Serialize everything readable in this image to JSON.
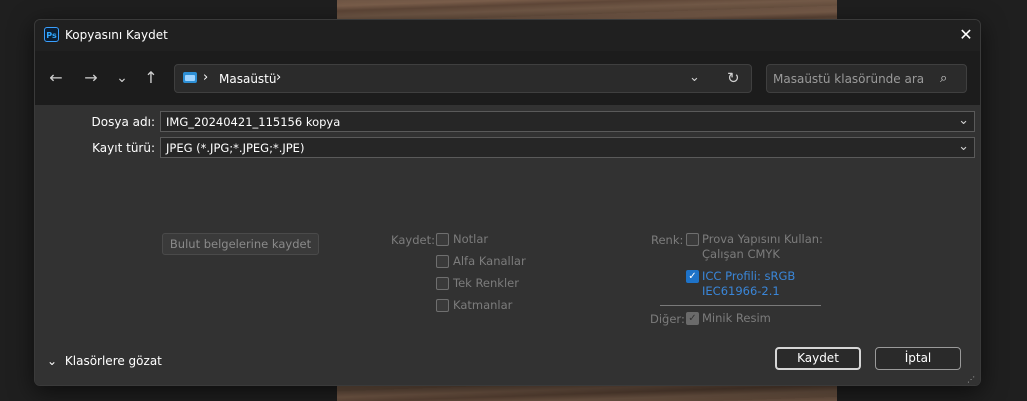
{
  "window": {
    "title": "Kopyasını Kaydet",
    "app_icon_text": "Ps",
    "close_glyph": "✕"
  },
  "nav": {
    "back": "←",
    "forward": "→",
    "recent": "⌄",
    "up": "↑",
    "address": {
      "location": "Masaüstü",
      "chevron": "›",
      "dropdown": "⌄",
      "refresh": "↻"
    },
    "search": {
      "placeholder": "Masaüstü klasöründe ara",
      "icon": "⌕"
    }
  },
  "form": {
    "filename_label": "Dosya adı:",
    "filename_value": "IMG_20240421_115156 kopya",
    "filetype_label": "Kayıt türü:",
    "filetype_value": "JPEG (*.JPG;*.JPEG;*.JPE)",
    "dropdown": "⌄"
  },
  "cloud_button": "Bulut belgelerine kaydet",
  "save_group": {
    "label": "Kaydet:",
    "options": [
      {
        "label": "Notlar",
        "checked": false
      },
      {
        "label": "Alfa Kanallar",
        "checked": false
      },
      {
        "label": "Tek Renkler",
        "checked": false
      },
      {
        "label": "Katmanlar",
        "checked": false
      }
    ]
  },
  "color_group": {
    "label": "Renk:",
    "proof_line1": "Prova Yapısını Kullan:",
    "proof_line2": "Çalışan CMYK",
    "icc_line1": "ICC Profili: sRGB",
    "icc_line2": "IEC61966-2.1",
    "check_mark": "✓"
  },
  "other_group": {
    "label": "Diğer:",
    "thumbnail": "Minik Resim"
  },
  "browse_folders": {
    "chevron": "⌄",
    "label": "Klasörlere gözat"
  },
  "buttons": {
    "save": "Kaydet",
    "cancel": "İptal"
  },
  "colors": {
    "accent": "#1e73c9",
    "dialog_bg": "#323232",
    "header_bg": "#1c1c1c",
    "title_bg": "#202020"
  }
}
